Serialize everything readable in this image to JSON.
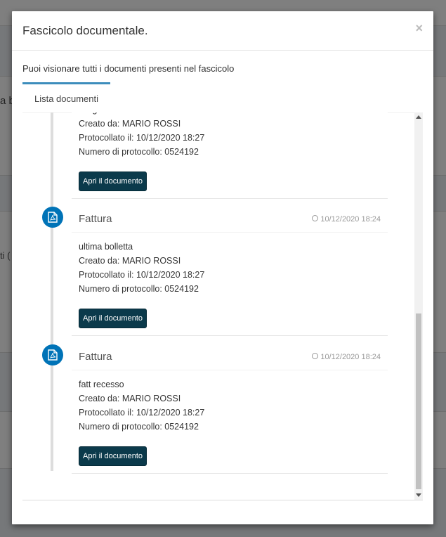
{
  "background": {
    "fragment_1": "a b",
    "fragment_2": "ti ("
  },
  "modal": {
    "title": "Fascicolo documentale.",
    "close": "×",
    "intro": "Puoi visionare tutti i documenti presenti nel fascicolo",
    "tab_label": "Lista documenti"
  },
  "documents": [
    {
      "title": "",
      "time": "",
      "description": "allega",
      "created_by": "Creato da: MARIO ROSSI",
      "protocol_date": "Protocollato il: 10/12/2020 18:27",
      "protocol_number": "Numero di protocollo: 0524192",
      "button": "Apri il documento"
    },
    {
      "title": "Fattura",
      "time": "10/12/2020 18:24",
      "description": "ultima bolletta",
      "created_by": "Creato da: MARIO ROSSI",
      "protocol_date": "Protocollato il: 10/12/2020 18:27",
      "protocol_number": "Numero di protocollo: 0524192",
      "button": "Apri il documento"
    },
    {
      "title": "Fattura",
      "time": "10/12/2020 18:24",
      "description": "fatt recesso",
      "created_by": "Creato da: MARIO ROSSI",
      "protocol_date": "Protocollato il: 10/12/2020 18:27",
      "protocol_number": "Numero di protocollo: 0524192",
      "button": "Apri il documento"
    }
  ],
  "icons": {
    "document": "file-pdf-icon",
    "time": "clock-icon",
    "close": "close-icon"
  },
  "colors": {
    "accent": "#3c8dbc",
    "icon_bg": "#0073b7",
    "button_bg": "#0b3a4b"
  }
}
